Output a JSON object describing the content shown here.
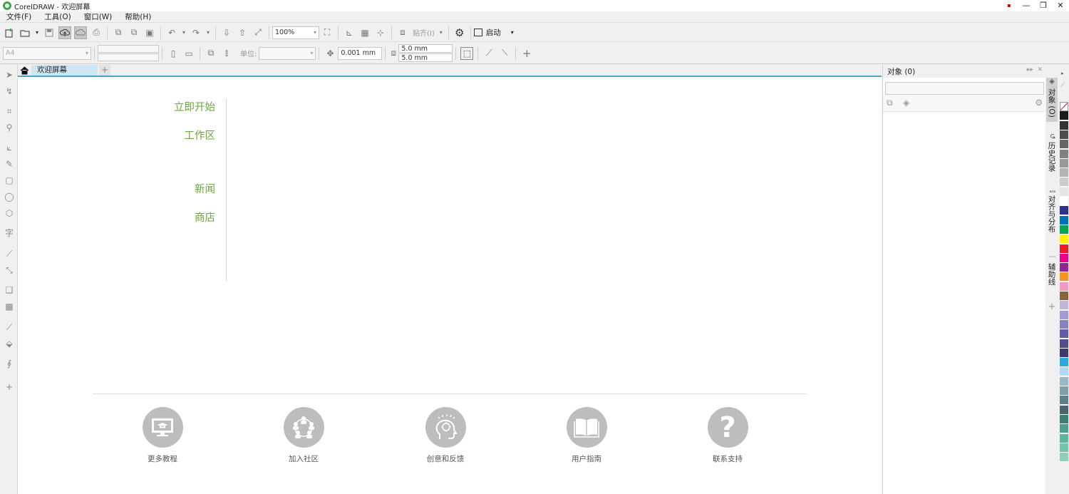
{
  "window": {
    "title": "CorelDRAW - 欢迎屏幕",
    "controls": [
      "minimize-icon",
      "restore-icon",
      "close-icon"
    ]
  },
  "menu": [
    "文件(F)",
    "工具(O)",
    "窗口(W)",
    "帮助(H)"
  ],
  "toolbar": {
    "zoom": "100%",
    "paste_label": "贴齐(I)",
    "launch_label": "启动"
  },
  "propbar": {
    "page_size": "A4",
    "units_label": "单位:",
    "nudge": "0.001 mm",
    "dup_x": "5.0 mm",
    "dup_y": "5.0 mm"
  },
  "tabs": {
    "welcome": "欢迎屏幕"
  },
  "welcome": {
    "nav": [
      "立即开始",
      "工作区",
      "新闻",
      "商店"
    ],
    "quick_links": [
      {
        "label": "更多教程",
        "icon": "monitor-graduation-icon"
      },
      {
        "label": "加入社区",
        "icon": "community-people-icon"
      },
      {
        "label": "创意和反馈",
        "icon": "idea-head-icon"
      },
      {
        "label": "用户指南",
        "icon": "open-book-icon"
      },
      {
        "label": "联系支持",
        "icon": "question-mark-icon"
      }
    ]
  },
  "objects_panel": {
    "title": "对象 (0)"
  },
  "dock_tabs": [
    "对象 (O)",
    "历史记录",
    "对齐与分布",
    "辅助线"
  ],
  "palette": [
    "#ffffff",
    "#1a1a1a",
    "#333333",
    "#4d4d4d",
    "#666666",
    "#808080",
    "#999999",
    "#b3b3b3",
    "#cccccc",
    "#e6e6e6",
    "#ffffff",
    "#2e3192",
    "#0072bc",
    "#00a651",
    "#fff200",
    "#ed1c24",
    "#ec008c",
    "#92278f",
    "#f7941d",
    "#f49ac1",
    "#8c6239",
    "#c2b5dc",
    "#a39bd0",
    "#8781bd",
    "#605ca8",
    "#524d8f",
    "#3f3a6e",
    "#29abe2",
    "#b3d7f0",
    "#9bb8c6",
    "#7da0ae",
    "#5f7f8c",
    "#4b6570",
    "#3d7f75",
    "#4e9e8f",
    "#5fb49f",
    "#74c4ab",
    "#8dd2b7"
  ]
}
